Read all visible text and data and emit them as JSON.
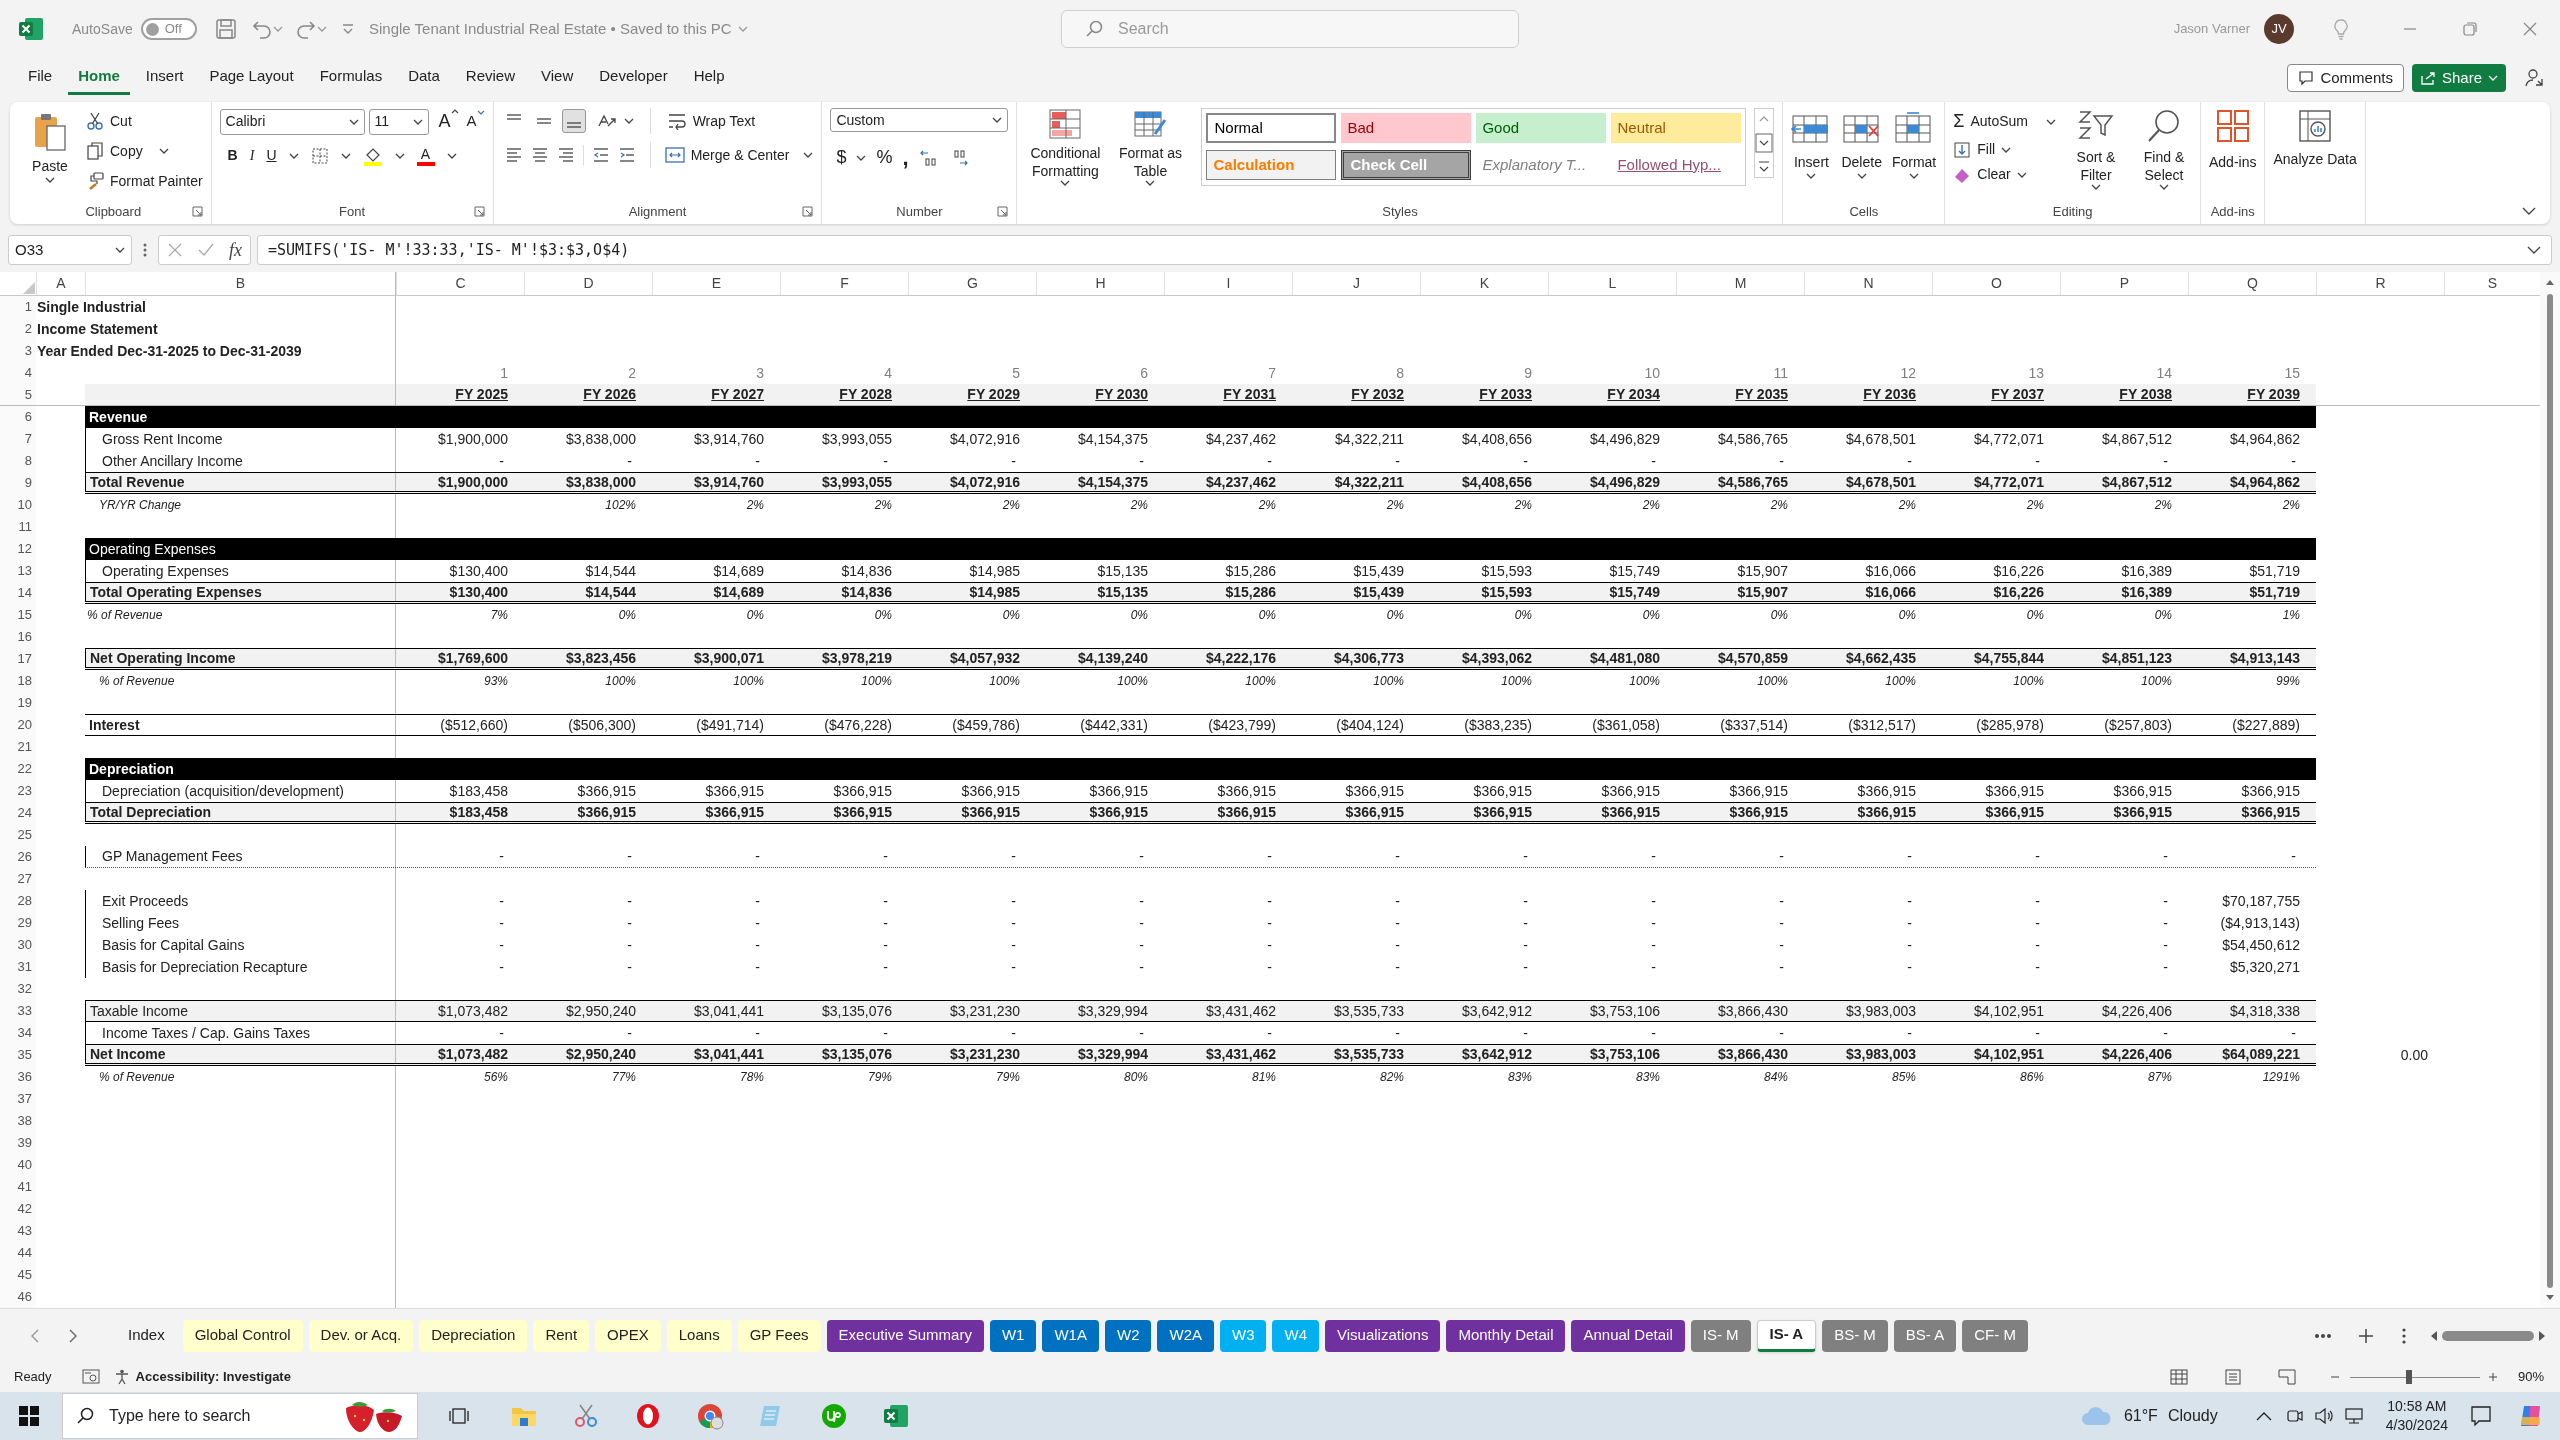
{
  "title_bar": {
    "autosave_label": "AutoSave",
    "autosave_on": false,
    "autosave_state": "Off",
    "document_title": "Single Tenant Industrial Real Estate • Saved to this PC",
    "search_placeholder": "Search",
    "user_name": "Jason Varner",
    "avatar_initials": "JV"
  },
  "menu_tabs": [
    {
      "label": "File",
      "selected": false
    },
    {
      "label": "Home",
      "selected": true
    },
    {
      "label": "Insert",
      "selected": false
    },
    {
      "label": "Page Layout",
      "selected": false
    },
    {
      "label": "Formulas",
      "selected": false
    },
    {
      "label": "Data",
      "selected": false
    },
    {
      "label": "Review",
      "selected": false
    },
    {
      "label": "View",
      "selected": false
    },
    {
      "label": "Developer",
      "selected": false
    },
    {
      "label": "Help",
      "selected": false
    }
  ],
  "comments_button": "Comments",
  "share_button": "Share",
  "ribbon": {
    "clipboard": {
      "paste": "Paste",
      "cut": "Cut",
      "copy": "Copy",
      "format_painter": "Format Painter",
      "label": "Clipboard"
    },
    "font": {
      "name": "Calibri",
      "size": "11",
      "grow": "A",
      "shrink": "A",
      "bold": "B",
      "italic": "I",
      "underline": "U",
      "color_letter": "A",
      "label": "Font"
    },
    "alignment": {
      "vertical_buttons": [
        {
          "selected": false
        },
        {
          "selected": false
        },
        {
          "selected": true
        }
      ],
      "wrap_text": "Wrap Text",
      "merge_center": "Merge & Center",
      "label": "Alignment"
    },
    "number": {
      "format": "Custom",
      "currency": "$",
      "percent": "%",
      "comma": ",",
      "label": "Number"
    },
    "styles": {
      "conditional": "Conditional Formatting",
      "format_table": "Format as Table",
      "label": "Styles",
      "gallery": [
        {
          "label": "Normal",
          "kind": "normal"
        },
        {
          "label": "Bad",
          "kind": "bad"
        },
        {
          "label": "Good",
          "kind": "good"
        },
        {
          "label": "Neutral",
          "kind": "neutral"
        },
        {
          "label": "Calculation",
          "kind": "calculation"
        },
        {
          "label": "Check Cell",
          "kind": "check"
        },
        {
          "label": "Explanatory T...",
          "kind": "explanatory"
        },
        {
          "label": "Followed Hyp...",
          "kind": "hyperlink"
        }
      ]
    },
    "cells": {
      "insert": "Insert",
      "delete": "Delete",
      "format": "Format",
      "label": "Cells"
    },
    "editing": {
      "sigma": "Σ",
      "autosum": "AutoSum",
      "fill": "Fill",
      "clear": "Clear",
      "sort_filter": "Sort & Filter",
      "find_select": "Find & Select",
      "label": "Editing"
    },
    "add_ins": {
      "button": "Add-ins",
      "label": "Add-ins"
    },
    "analyze": {
      "button": "Analyze Data"
    }
  },
  "formula_bar": {
    "name_box": "O33",
    "fx": "fx",
    "formula": "=SUMIFS('IS- M'!33:33,'IS- M'!$3:$3,O$4)"
  },
  "sheet": {
    "columns": [
      "A",
      "B",
      "C",
      "D",
      "E",
      "F",
      "G",
      "H",
      "I",
      "J",
      "K",
      "L",
      "M",
      "N",
      "O",
      "P",
      "Q",
      "R",
      "S"
    ],
    "row_numbers": [
      "1",
      "2",
      "3",
      "4",
      "5",
      "6",
      "7",
      "8",
      "9",
      "10",
      "11",
      "12",
      "13",
      "14",
      "15",
      "16",
      "17",
      "18",
      "19",
      "20",
      "21",
      "22",
      "23",
      "24",
      "25",
      "26",
      "27",
      "28",
      "29",
      "30",
      "31",
      "32",
      "33",
      "34",
      "35",
      "36",
      "37",
      "38",
      "39",
      "40",
      "41",
      "42",
      "43",
      "44",
      "45",
      "46"
    ],
    "rows": [
      {
        "kind": "title",
        "label": "Single Industrial"
      },
      {
        "kind": "title",
        "label": "Income Statement"
      },
      {
        "kind": "title",
        "label": "Year Ended Dec-31-2025 to Dec-31-2039"
      },
      {
        "kind": "index",
        "values": [
          "1",
          "2",
          "3",
          "4",
          "5",
          "6",
          "7",
          "8",
          "9",
          "10",
          "11",
          "12",
          "13",
          "14",
          "15"
        ]
      },
      {
        "kind": "header",
        "values": [
          "FY 2025",
          "FY 2026",
          "FY 2027",
          "FY 2028",
          "FY 2029",
          "FY 2030",
          "FY 2031",
          "FY 2032",
          "FY 2033",
          "FY 2034",
          "FY 2035",
          "FY 2036",
          "FY 2037",
          "FY 2038",
          "FY 2039"
        ]
      },
      {
        "kind": "section",
        "bold": true,
        "label": "Revenue"
      },
      {
        "kind": "item",
        "label": "Gross Rent Income",
        "values": [
          "$1,900,000",
          "$3,838,000",
          "$3,914,760",
          "$3,993,055",
          "$4,072,916",
          "$4,154,375",
          "$4,237,462",
          "$4,322,211",
          "$4,408,656",
          "$4,496,829",
          "$4,586,765",
          "$4,678,501",
          "$4,772,071",
          "$4,867,512",
          "$4,964,862"
        ]
      },
      {
        "kind": "item",
        "label": "Other Ancillary Income",
        "values": [
          "-",
          "-",
          "-",
          "-",
          "-",
          "-",
          "-",
          "-",
          "-",
          "-",
          "-",
          "-",
          "-",
          "-",
          "-"
        ]
      },
      {
        "kind": "total",
        "label": "Total Revenue",
        "values": [
          "$1,900,000",
          "$3,838,000",
          "$3,914,760",
          "$3,993,055",
          "$4,072,916",
          "$4,154,375",
          "$4,237,462",
          "$4,322,211",
          "$4,408,656",
          "$4,496,829",
          "$4,586,765",
          "$4,678,501",
          "$4,772,071",
          "$4,867,512",
          "$4,964,862"
        ]
      },
      {
        "kind": "pct",
        "indent": true,
        "blank_first": true,
        "label": "YR/YR Change",
        "values": [
          "102%",
          "2%",
          "2%",
          "2%",
          "2%",
          "2%",
          "2%",
          "2%",
          "2%",
          "2%",
          "2%",
          "2%",
          "2%",
          "2%"
        ]
      },
      {
        "kind": "blank"
      },
      {
        "kind": "section",
        "bold": false,
        "label": "Operating Expenses"
      },
      {
        "kind": "item",
        "label": "Operating Expenses",
        "values": [
          "$130,400",
          "$14,544",
          "$14,689",
          "$14,836",
          "$14,985",
          "$15,135",
          "$15,286",
          "$15,439",
          "$15,593",
          "$15,749",
          "$15,907",
          "$16,066",
          "$16,226",
          "$16,389",
          "$51,719"
        ]
      },
      {
        "kind": "total",
        "label": "Total Operating Expenses",
        "values": [
          "$130,400",
          "$14,544",
          "$14,689",
          "$14,836",
          "$14,985",
          "$15,135",
          "$15,286",
          "$15,439",
          "$15,593",
          "$15,749",
          "$15,907",
          "$16,066",
          "$16,226",
          "$16,389",
          "$51,719"
        ]
      },
      {
        "kind": "pct",
        "indent": false,
        "label": "% of Revenue",
        "values": [
          "7%",
          "0%",
          "0%",
          "0%",
          "0%",
          "0%",
          "0%",
          "0%",
          "0%",
          "0%",
          "0%",
          "0%",
          "0%",
          "0%",
          "1%"
        ]
      },
      {
        "kind": "blank"
      },
      {
        "kind": "total",
        "label": "Net Operating Income",
        "values": [
          "$1,769,600",
          "$3,823,456",
          "$3,900,071",
          "$3,978,219",
          "$4,057,932",
          "$4,139,240",
          "$4,222,176",
          "$4,306,773",
          "$4,393,062",
          "$4,481,080",
          "$4,570,859",
          "$4,662,435",
          "$4,755,844",
          "$4,851,123",
          "$4,913,143"
        ]
      },
      {
        "kind": "pct",
        "indent": true,
        "label": "% of Revenue",
        "values": [
          "93%",
          "100%",
          "100%",
          "100%",
          "100%",
          "100%",
          "100%",
          "100%",
          "100%",
          "100%",
          "100%",
          "100%",
          "100%",
          "100%",
          "99%"
        ]
      },
      {
        "kind": "blank"
      },
      {
        "kind": "line",
        "label": "Interest",
        "values": [
          "($512,660)",
          "($506,300)",
          "($491,714)",
          "($476,228)",
          "($459,786)",
          "($442,331)",
          "($423,799)",
          "($404,124)",
          "($383,235)",
          "($361,058)",
          "($337,514)",
          "($312,517)",
          "($285,978)",
          "($257,803)",
          "($227,889)"
        ]
      },
      {
        "kind": "blank"
      },
      {
        "kind": "section",
        "bold": true,
        "label": "Depreciation"
      },
      {
        "kind": "item",
        "label": "Depreciation (acquisition/development)",
        "values": [
          "$183,458",
          "$366,915",
          "$366,915",
          "$366,915",
          "$366,915",
          "$366,915",
          "$366,915",
          "$366,915",
          "$366,915",
          "$366,915",
          "$366,915",
          "$366,915",
          "$366,915",
          "$366,915",
          "$366,915"
        ]
      },
      {
        "kind": "total",
        "label": "Total Depreciation",
        "values": [
          "$183,458",
          "$366,915",
          "$366,915",
          "$366,915",
          "$366,915",
          "$366,915",
          "$366,915",
          "$366,915",
          "$366,915",
          "$366,915",
          "$366,915",
          "$366,915",
          "$366,915",
          "$366,915",
          "$366,915"
        ]
      },
      {
        "kind": "blank"
      },
      {
        "kind": "item",
        "dotted_rule": true,
        "label": "GP Management Fees",
        "values": [
          "-",
          "-",
          "-",
          "-",
          "-",
          "-",
          "-",
          "-",
          "-",
          "-",
          "-",
          "-",
          "-",
          "-",
          "-"
        ]
      },
      {
        "kind": "blank"
      },
      {
        "kind": "item",
        "label": "Exit Proceeds",
        "values": [
          "-",
          "-",
          "-",
          "-",
          "-",
          "-",
          "-",
          "-",
          "-",
          "-",
          "-",
          "-",
          "-",
          "-",
          "$70,187,755"
        ]
      },
      {
        "kind": "item",
        "label": "Selling Fees",
        "values": [
          "-",
          "-",
          "-",
          "-",
          "-",
          "-",
          "-",
          "-",
          "-",
          "-",
          "-",
          "-",
          "-",
          "-",
          "($4,913,143)"
        ]
      },
      {
        "kind": "item",
        "label": "Basis for Capital Gains",
        "values": [
          "-",
          "-",
          "-",
          "-",
          "-",
          "-",
          "-",
          "-",
          "-",
          "-",
          "-",
          "-",
          "-",
          "-",
          "$54,450,612"
        ]
      },
      {
        "kind": "item",
        "label": "Basis for Depreciation Recapture",
        "values": [
          "-",
          "-",
          "-",
          "-",
          "-",
          "-",
          "-",
          "-",
          "-",
          "-",
          "-",
          "-",
          "-",
          "-",
          "$5,320,271"
        ]
      },
      {
        "kind": "blank"
      },
      {
        "kind": "subtotal",
        "label": "Taxable Income",
        "values": [
          "$1,073,482",
          "$2,950,240",
          "$3,041,441",
          "$3,135,076",
          "$3,231,230",
          "$3,329,994",
          "$3,431,462",
          "$3,535,733",
          "$3,642,912",
          "$3,753,106",
          "$3,866,430",
          "$3,983,003",
          "$4,102,951",
          "$4,226,406",
          "$4,318,338"
        ]
      },
      {
        "kind": "item",
        "label": "Income Taxes / Cap. Gains Taxes",
        "values": [
          "-",
          "-",
          "-",
          "-",
          "-",
          "-",
          "-",
          "-",
          "-",
          "-",
          "-",
          "-",
          "-",
          "-",
          "-"
        ]
      },
      {
        "kind": "total",
        "label": "Net Income",
        "extra": "0.00",
        "values": [
          "$1,073,482",
          "$2,950,240",
          "$3,041,441",
          "$3,135,076",
          "$3,231,230",
          "$3,329,994",
          "$3,431,462",
          "$3,535,733",
          "$3,642,912",
          "$3,753,106",
          "$3,866,430",
          "$3,983,003",
          "$4,102,951",
          "$4,226,406",
          "$64,089,221"
        ]
      },
      {
        "kind": "pct",
        "indent": true,
        "label": "% of Revenue",
        "values": [
          "56%",
          "77%",
          "78%",
          "79%",
          "79%",
          "80%",
          "81%",
          "82%",
          "83%",
          "83%",
          "84%",
          "85%",
          "86%",
          "87%",
          "1291%"
        ]
      }
    ]
  },
  "sheet_tabs": [
    {
      "label": "Index",
      "selected": false
    },
    {
      "label": "Global Control",
      "selected": false,
      "color": "#ffffcc"
    },
    {
      "label": "Dev. or Acq.",
      "selected": false,
      "color": "#ffffcc"
    },
    {
      "label": "Depreciation",
      "selected": false,
      "color": "#ffffcc"
    },
    {
      "label": "Rent",
      "selected": false,
      "color": "#ffffcc"
    },
    {
      "label": "OPEX",
      "selected": false,
      "color": "#ffffcc"
    },
    {
      "label": "Loans",
      "selected": false,
      "color": "#ffffcc"
    },
    {
      "label": "GP Fees",
      "selected": false,
      "color": "#ffffcc"
    },
    {
      "label": "Executive Summary",
      "selected": false,
      "color": "#7030a0"
    },
    {
      "label": "W1",
      "selected": false,
      "color": "#0070c0"
    },
    {
      "label": "W1A",
      "selected": false,
      "color": "#0070c0"
    },
    {
      "label": "W2",
      "selected": false,
      "color": "#0070c0"
    },
    {
      "label": "W2A",
      "selected": false,
      "color": "#0070c0"
    },
    {
      "label": "W3",
      "selected": false,
      "color": "#00b0f0"
    },
    {
      "label": "W4",
      "selected": false,
      "color": "#00b0f0"
    },
    {
      "label": "Visualizations",
      "selected": false,
      "color": "#7030a0"
    },
    {
      "label": "Monthly Detail",
      "selected": false,
      "color": "#7030a0"
    },
    {
      "label": "Annual Detail",
      "selected": false,
      "color": "#7030a0"
    },
    {
      "label": "IS- M",
      "selected": false,
      "color": "#808080"
    },
    {
      "label": "IS- A",
      "selected": true
    },
    {
      "label": "BS- M",
      "selected": false,
      "color": "#808080"
    },
    {
      "label": "BS- A",
      "selected": false,
      "color": "#808080"
    },
    {
      "label": "CF- M",
      "selected": false,
      "color": "#808080"
    }
  ],
  "status_bar": {
    "ready": "Ready",
    "accessibility": "Accessibility: Investigate",
    "zoom_slider": {
      "level": 0.45
    },
    "zoom": "90%"
  },
  "taskbar": {
    "search_placeholder": "Type here to search",
    "temperature": "61°F",
    "condition": "Cloudy",
    "time": "10:58 AM",
    "date": "4/30/2024"
  }
}
